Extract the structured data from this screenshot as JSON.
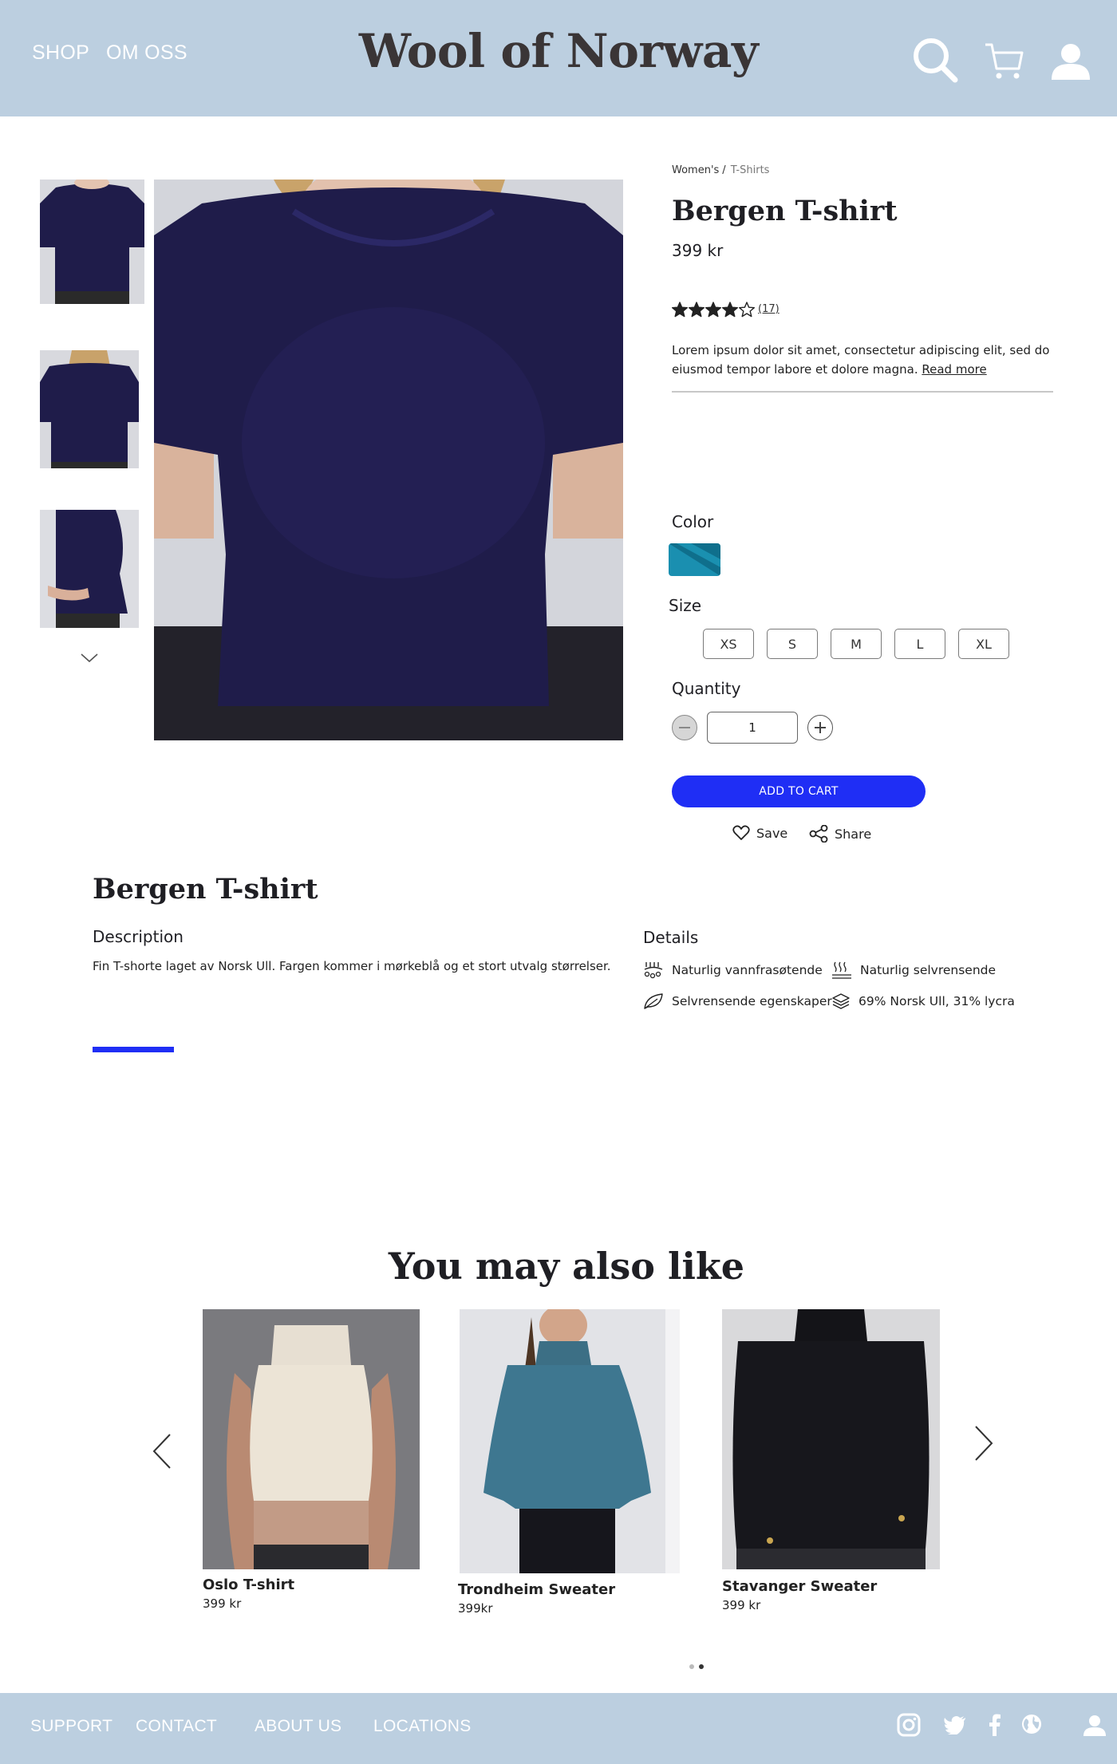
{
  "header": {
    "nav": [
      "SHOP",
      "OM OSS"
    ],
    "brand": "Wool of Norway",
    "icons": [
      "search-icon",
      "cart-icon",
      "user-icon"
    ]
  },
  "product": {
    "breadcrumb": [
      "Women's",
      "T-Shirts"
    ],
    "title": "Bergen T-shirt",
    "price": "399 kr",
    "rating": 4,
    "rating_max": 5,
    "review_count": "(17)",
    "description": "Lorem ipsum dolor sit amet, consectetur adipiscing elit, sed do eiusmod tempor labore et dolore magna.",
    "read_more": "Read more",
    "color_label": "Color",
    "size_label": "Size",
    "sizes": [
      "XS",
      "S",
      "M",
      "L",
      "XL"
    ],
    "quantity_label": "Quantity",
    "quantity": "1",
    "add_to_cart": "ADD TO CART",
    "save": "Save",
    "share": "Share"
  },
  "details": {
    "title": "Bergen T-shirt",
    "description_label": "Description",
    "description": "Fin T-shorte laget av Norsk Ull. Fargen kommer i mørkeblå og et stort utvalg størrelser.",
    "details_label": "Details",
    "features": [
      {
        "icon": "water-repellent-icon",
        "text": "Naturlig vannfrasøtende"
      },
      {
        "icon": "self-cleaning-icon",
        "text": "Naturlig selvrensende"
      },
      {
        "icon": "leaf-icon",
        "text": "Selvrensende egenskaper"
      },
      {
        "icon": "layers-icon",
        "text": "69% Norsk Ull, 31% lycra"
      }
    ]
  },
  "recommendations": {
    "title": "You may also like",
    "items": [
      {
        "name": "Oslo T-shirt",
        "price": "399 kr"
      },
      {
        "name": "Trondheim Sweater",
        "price": "399kr"
      },
      {
        "name": "Stavanger Sweater",
        "price": "399 kr"
      }
    ],
    "pages": 2,
    "active_page": 2
  },
  "footer": {
    "links": [
      "SUPPORT",
      "CONTACT",
      "ABOUT US",
      "LOCATIONS"
    ],
    "icons": [
      "instagram-icon",
      "twitter-icon",
      "facebook-icon",
      "globe-icon",
      "user-icon"
    ]
  },
  "colors": {
    "header_bg": "#bccfe0",
    "accent": "#1f2ef5",
    "sweater": "#1f1c4a"
  }
}
